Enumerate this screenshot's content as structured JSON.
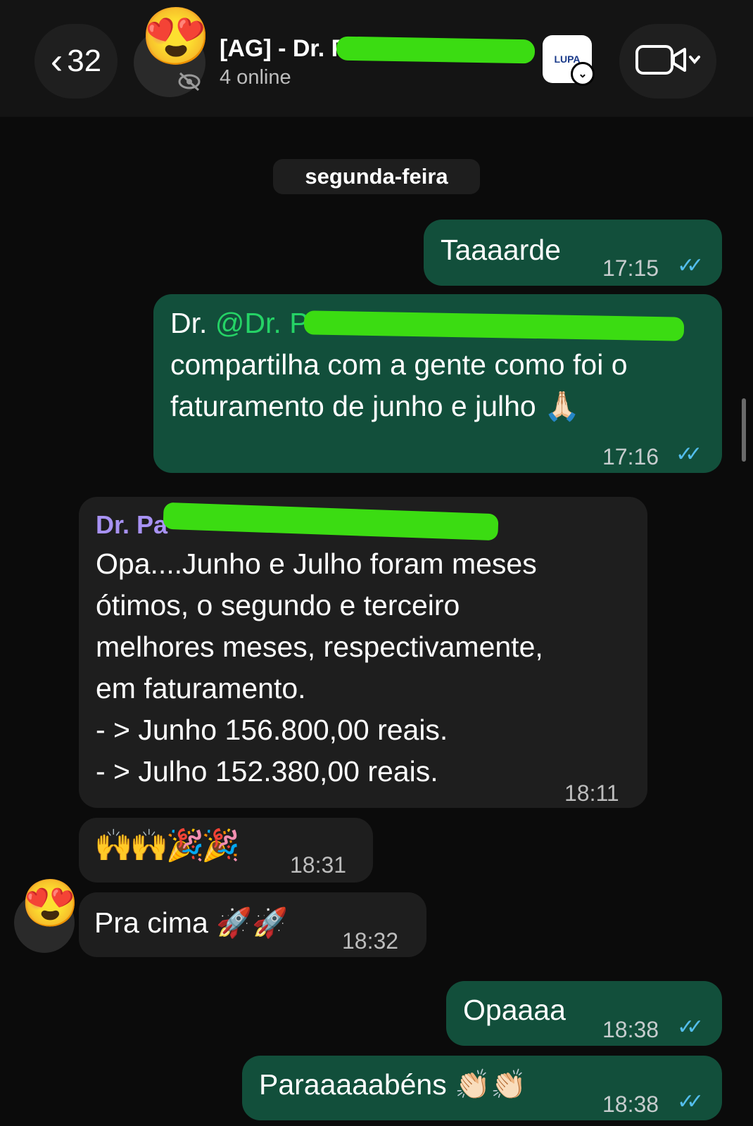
{
  "header": {
    "back_count": "32",
    "chat_title": "[AG] - Dr. P",
    "subtitle": "4 online",
    "lupa_label": "LUPA"
  },
  "date_separator": "segunda-feira",
  "messages": [
    {
      "text": "Taaaarde",
      "time": "17:15"
    },
    {
      "prefix": "Dr. ",
      "mention": "@Dr. Pa",
      "body": "compartilha com a gente como foi o faturamento de junho e julho 🙏🏻",
      "time": "17:16"
    },
    {
      "sender": "Dr. Pa",
      "lines": [
        "Opa....Junho e Julho foram meses",
        "ótimos, o segundo e terceiro",
        "melhores meses, respectivamente,",
        "em faturamento.",
        "- > Junho 156.800,00 reais.",
        "- > Julho 152.380,00 reais."
      ],
      "time": "18:11"
    },
    {
      "text": "🙌🙌🎉🎉",
      "time": "18:31"
    },
    {
      "text": "Pra cima 🚀🚀",
      "time": "18:32"
    },
    {
      "text": "Opaaaa",
      "time": "18:38"
    },
    {
      "text": "Paraaaaabéns 👏🏻👏🏻",
      "time": "18:38"
    }
  ],
  "colors": {
    "outgoing_bubble": "#124f3b",
    "incoming_bubble": "#1e1e1e",
    "mention": "#25d366",
    "sender_name": "#a892f4",
    "read_ticks": "#53bdeb",
    "redaction": "#3bdc12"
  },
  "icons": [
    "chevron-left-icon",
    "heart-eyes-emoji",
    "eye-slash-icon",
    "video-camera-icon",
    "chevron-down-icon",
    "double-check-icon"
  ]
}
